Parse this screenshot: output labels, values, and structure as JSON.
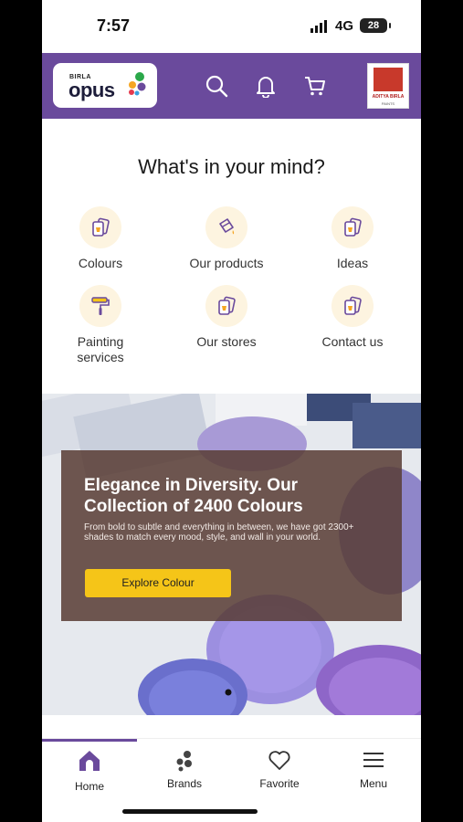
{
  "status": {
    "time": "7:57",
    "network": "4G",
    "battery": "28"
  },
  "header": {
    "logo_small": "BIRLA",
    "logo_main": "opus",
    "brand_line1": "ADITYA BIRLA",
    "brand_line2": "PAINTS",
    "icons": [
      "search-icon",
      "bell-icon",
      "cart-icon"
    ],
    "bg_color": "#6a4a9c"
  },
  "main": {
    "question": "What's in your mind?",
    "options": [
      {
        "label": "Colours",
        "icon": "paint-cards-icon"
      },
      {
        "label": "Our products",
        "icon": "paint-bucket-icon"
      },
      {
        "label": "Ideas",
        "icon": "paint-cards-icon"
      },
      {
        "label": "Painting services",
        "icon": "paint-roller-icon"
      },
      {
        "label": "Our stores",
        "icon": "paint-cards-icon"
      },
      {
        "label": "Contact us",
        "icon": "paint-cards-icon"
      }
    ]
  },
  "hero": {
    "title": "Elegance in Diversity. Our Collection of 2400 Colours",
    "body": "From bold to subtle and everything in between, we have got 2300+ shades to match every mood, style, and wall in your world.",
    "cta": "Explore Colour",
    "cta_color": "#f5c518"
  },
  "bottom_nav": {
    "items": [
      {
        "label": "Home",
        "icon": "home-icon",
        "active": true
      },
      {
        "label": "Brands",
        "icon": "brands-icon"
      },
      {
        "label": "Favorite",
        "icon": "heart-icon"
      },
      {
        "label": "Menu",
        "icon": "menu-icon"
      }
    ]
  }
}
